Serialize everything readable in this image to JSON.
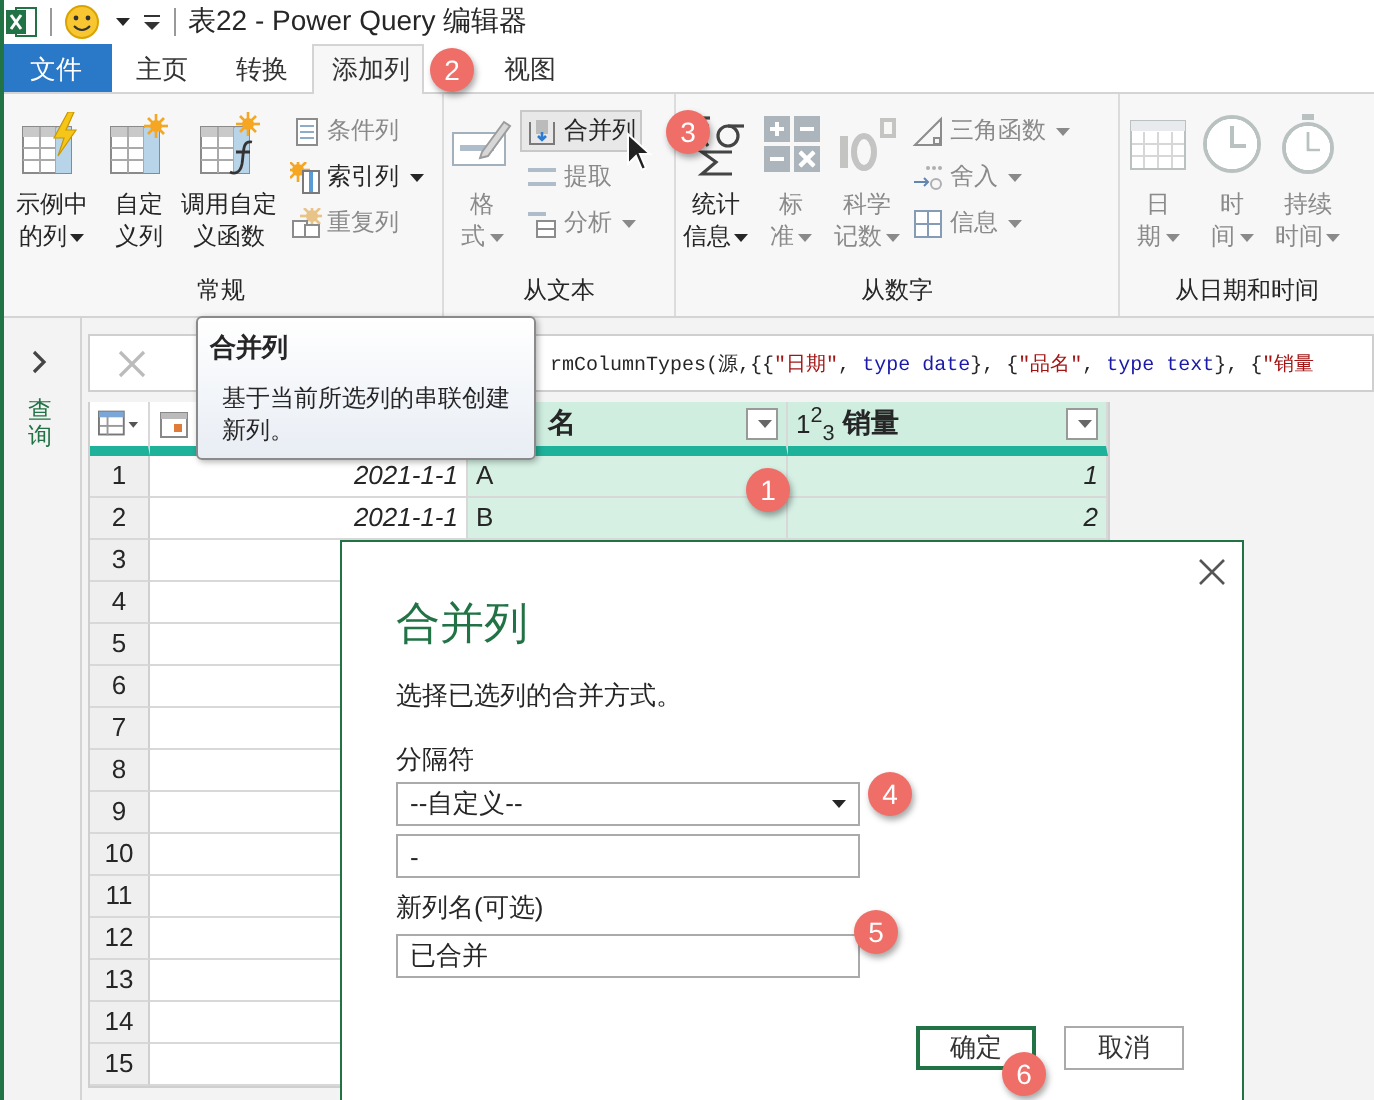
{
  "window": {
    "title": "表22 - Power Query 编辑器"
  },
  "tabs": [
    {
      "label": "文件",
      "kind": "file",
      "selected": false
    },
    {
      "label": "主页",
      "kind": "tab",
      "selected": false
    },
    {
      "label": "转换",
      "kind": "tab",
      "selected": false
    },
    {
      "label": "添加列",
      "kind": "tab",
      "selected": true
    },
    {
      "label": "视图",
      "kind": "tab",
      "selected": false
    }
  ],
  "ribbon": {
    "groups": [
      {
        "label": "常规",
        "items": [
          {
            "kind": "large",
            "label": "示例中的列",
            "dropdown": true,
            "disabled": false,
            "highlighted": false
          },
          {
            "kind": "large",
            "label": "自定义列",
            "dropdown": false,
            "disabled": false,
            "highlighted": false
          },
          {
            "kind": "large",
            "label": "调用自定义函数",
            "dropdown": false,
            "disabled": false,
            "highlighted": false
          },
          {
            "kind": "small",
            "label": "条件列",
            "dropdown": false,
            "disabled": true,
            "highlighted": false
          },
          {
            "kind": "small",
            "label": "索引列",
            "dropdown": true,
            "disabled": false,
            "highlighted": false
          },
          {
            "kind": "small",
            "label": "重复列",
            "dropdown": false,
            "disabled": true,
            "highlighted": false
          }
        ]
      },
      {
        "label": "从文本",
        "items": [
          {
            "kind": "large",
            "label": "格式",
            "dropdown": true,
            "disabled": true,
            "highlighted": false
          },
          {
            "kind": "small",
            "label": "合并列",
            "dropdown": false,
            "disabled": false,
            "highlighted": true
          },
          {
            "kind": "small",
            "label": "提取",
            "dropdown": false,
            "disabled": true,
            "highlighted": false
          },
          {
            "kind": "small",
            "label": "分析",
            "dropdown": true,
            "disabled": true,
            "highlighted": false
          }
        ]
      },
      {
        "label": "从数字",
        "items": [
          {
            "kind": "large",
            "label": "统计信息",
            "dropdown": true,
            "disabled": false,
            "highlighted": false
          },
          {
            "kind": "large",
            "label": "标准",
            "dropdown": true,
            "disabled": true,
            "highlighted": false
          },
          {
            "kind": "large",
            "label": "科学记数",
            "dropdown": true,
            "disabled": true,
            "highlighted": false
          },
          {
            "kind": "small",
            "label": "三角函数",
            "dropdown": true,
            "disabled": true,
            "highlighted": false
          },
          {
            "kind": "small",
            "label": "舍入",
            "dropdown": true,
            "disabled": true,
            "highlighted": false
          },
          {
            "kind": "small",
            "label": "信息",
            "dropdown": true,
            "disabled": true,
            "highlighted": false
          }
        ]
      },
      {
        "label": "从日期和时间",
        "items": [
          {
            "kind": "large",
            "label": "日期",
            "dropdown": true,
            "disabled": true,
            "highlighted": false
          },
          {
            "kind": "large",
            "label": "时间",
            "dropdown": true,
            "disabled": true,
            "highlighted": false
          },
          {
            "kind": "large",
            "label": "持续时间",
            "dropdown": true,
            "disabled": true,
            "highlighted": false
          }
        ]
      }
    ]
  },
  "queries_pane": {
    "label": "查询"
  },
  "formula_bar": {
    "tokens": [
      {
        "text": "rmColumnTypes(源,{{",
        "kind": "plain"
      },
      {
        "text": "\"日期\"",
        "kind": "string"
      },
      {
        "text": ", ",
        "kind": "plain"
      },
      {
        "text": "type date",
        "kind": "keyword"
      },
      {
        "text": "}, {",
        "kind": "plain"
      },
      {
        "text": "\"品名\"",
        "kind": "string"
      },
      {
        "text": ", ",
        "kind": "plain"
      },
      {
        "text": "type text",
        "kind": "keyword"
      },
      {
        "text": "}, {",
        "kind": "plain"
      },
      {
        "text": "\"销量",
        "kind": "string"
      }
    ]
  },
  "table": {
    "columns": [
      {
        "kind": "date",
        "selected": false
      },
      {
        "kind": "text",
        "title": "名",
        "selected": true
      },
      {
        "kind": "number",
        "type_label": "1$^{2}$$_{3}$",
        "title": "销量",
        "selected": true
      }
    ],
    "rows": [
      {
        "number": "1",
        "cells": [
          "2021-1-1",
          "A",
          "1"
        ]
      },
      {
        "number": "2",
        "cells": [
          "2021-1-1",
          "B",
          "2"
        ]
      },
      {
        "number": "3"
      },
      {
        "number": "4"
      },
      {
        "number": "5"
      },
      {
        "number": "6"
      },
      {
        "number": "7"
      },
      {
        "number": "8"
      },
      {
        "number": "9"
      },
      {
        "number": "10"
      },
      {
        "number": "11"
      },
      {
        "number": "12"
      },
      {
        "number": "13"
      },
      {
        "number": "14"
      },
      {
        "number": "15"
      }
    ]
  },
  "tooltip": {
    "title": "合并列",
    "text": "基于当前所选列的串联创建新列。"
  },
  "dialog": {
    "title": "合并列",
    "description": "选择已选列的合并方式。",
    "separator_label": "分隔符",
    "separator_value": "--自定义--",
    "custom_separator": "-",
    "name_label": "新列名(可选)",
    "name_value": "已合并",
    "buttons": [
      {
        "label": "确定",
        "default": true
      },
      {
        "label": "取消",
        "default": false
      }
    ]
  },
  "callouts": [
    {
      "number": "1"
    },
    {
      "number": "2"
    },
    {
      "number": "3"
    },
    {
      "number": "4"
    },
    {
      "number": "5"
    },
    {
      "number": "6"
    }
  ]
}
